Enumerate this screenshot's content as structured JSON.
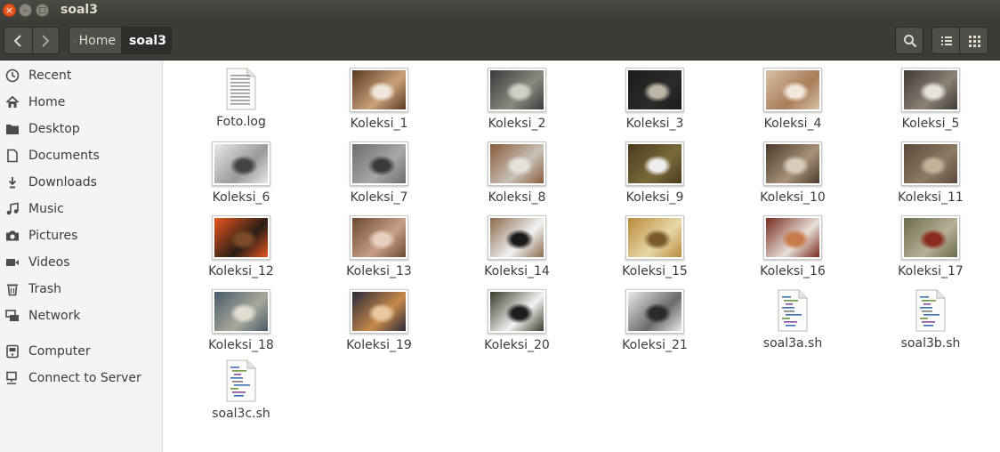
{
  "window": {
    "title": "soal3"
  },
  "header": {
    "breadcrumbs": [
      {
        "label": "Home"
      },
      {
        "label": "soal3"
      }
    ]
  },
  "sidebar": {
    "items": [
      {
        "label": "Recent",
        "icon": "clock-icon"
      },
      {
        "label": "Home",
        "icon": "home-icon"
      },
      {
        "label": "Desktop",
        "icon": "folder-icon"
      },
      {
        "label": "Documents",
        "icon": "document-icon"
      },
      {
        "label": "Downloads",
        "icon": "download-icon"
      },
      {
        "label": "Music",
        "icon": "music-icon"
      },
      {
        "label": "Pictures",
        "icon": "camera-icon"
      },
      {
        "label": "Videos",
        "icon": "video-icon"
      },
      {
        "label": "Trash",
        "icon": "trash-icon"
      },
      {
        "label": "Network",
        "icon": "network-icon"
      },
      {
        "label": "Computer",
        "icon": "computer-icon"
      },
      {
        "label": "Connect to Server",
        "icon": "server-icon"
      }
    ]
  },
  "files": [
    {
      "name": "Foto.log",
      "type": "text"
    },
    {
      "name": "Koleksi_1",
      "type": "image",
      "colors": [
        "#5a3a22",
        "#c9a27a",
        "#f0e6dc"
      ]
    },
    {
      "name": "Koleksi_2",
      "type": "image",
      "colors": [
        "#3a3a3a",
        "#8a8a82",
        "#cfcfc8"
      ]
    },
    {
      "name": "Koleksi_3",
      "type": "image",
      "colors": [
        "#1a1a1a",
        "#2c2c2c",
        "#bdb6a6"
      ]
    },
    {
      "name": "Koleksi_4",
      "type": "image",
      "colors": [
        "#d8c2a6",
        "#a87c58",
        "#f2e8dc"
      ]
    },
    {
      "name": "Koleksi_5",
      "type": "image",
      "colors": [
        "#3e3a36",
        "#8c8274",
        "#e6e2dc"
      ]
    },
    {
      "name": "Koleksi_6",
      "type": "image",
      "colors": [
        "#e8e8e8",
        "#9a9a9a",
        "#444444"
      ]
    },
    {
      "name": "Koleksi_7",
      "type": "image",
      "colors": [
        "#6c6c6c",
        "#a8a8a8",
        "#3a3a3a"
      ]
    },
    {
      "name": "Koleksi_8",
      "type": "image",
      "colors": [
        "#8a5a3a",
        "#c8c2b8",
        "#e6e2da"
      ]
    },
    {
      "name": "Koleksi_9",
      "type": "image",
      "colors": [
        "#4a3a1e",
        "#7a6a3a",
        "#eeeeee"
      ]
    },
    {
      "name": "Koleksi_10",
      "type": "image",
      "colors": [
        "#4a3a2a",
        "#a8927a",
        "#d8ccbc"
      ]
    },
    {
      "name": "Koleksi_11",
      "type": "image",
      "colors": [
        "#5a4a3a",
        "#8c7a64",
        "#c2b29a"
      ]
    },
    {
      "name": "Koleksi_12",
      "type": "image",
      "colors": [
        "#e8561e",
        "#2a1e16",
        "#7a4a2a"
      ]
    },
    {
      "name": "Koleksi_13",
      "type": "image",
      "colors": [
        "#6a4a2e",
        "#c8a088",
        "#e8d0c0"
      ]
    },
    {
      "name": "Koleksi_14",
      "type": "image",
      "colors": [
        "#8a6a4a",
        "#f2f2f2",
        "#1a1a1a"
      ]
    },
    {
      "name": "Koleksi_15",
      "type": "image",
      "colors": [
        "#b88a3a",
        "#e8d8a8",
        "#7a5a2a"
      ]
    },
    {
      "name": "Koleksi_16",
      "type": "image",
      "colors": [
        "#7a2a1e",
        "#e8e0d8",
        "#c87a4a"
      ]
    },
    {
      "name": "Koleksi_17",
      "type": "image",
      "colors": [
        "#6a6a4a",
        "#b8b098",
        "#8a2a1e"
      ]
    },
    {
      "name": "Koleksi_18",
      "type": "image",
      "colors": [
        "#4a5a6a",
        "#a8a89a",
        "#e0dcd0"
      ]
    },
    {
      "name": "Koleksi_19",
      "type": "image",
      "colors": [
        "#2a2a3a",
        "#c88a4a",
        "#e8c8a0"
      ]
    },
    {
      "name": "Koleksi_20",
      "type": "image",
      "colors": [
        "#3a3a2a",
        "#f2f2f2",
        "#1e1e1e"
      ]
    },
    {
      "name": "Koleksi_21",
      "type": "image",
      "colors": [
        "#e8e8e8",
        "#6a6a6a",
        "#2a2a2a"
      ]
    },
    {
      "name": "soal3a.sh",
      "type": "script"
    },
    {
      "name": "soal3b.sh",
      "type": "script"
    },
    {
      "name": "soal3c.sh",
      "type": "script"
    }
  ]
}
